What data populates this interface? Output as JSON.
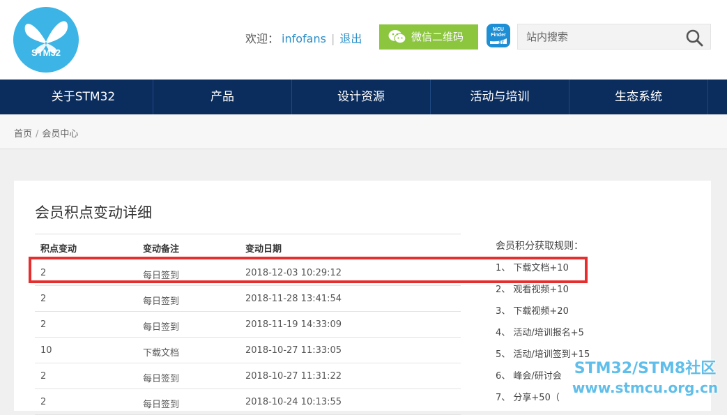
{
  "header": {
    "logo_text": "STM32",
    "welcome_label": "欢迎：",
    "username": "infofans",
    "separator": "|",
    "logout": "退出",
    "wechat_button": "微信二维码",
    "mcu_finder": {
      "line1": "MCU",
      "line2": "Finder",
      "brand": "ST"
    },
    "search_placeholder": "站内搜索",
    "brand_color": "#3cb4e5",
    "wechat_color": "#8cc63f"
  },
  "nav": {
    "background": "#0b2d5e",
    "items": [
      "关于STM32",
      "产品",
      "设计资源",
      "活动与培训",
      "生态系统"
    ]
  },
  "breadcrumb": {
    "home": "首页",
    "separator": "/",
    "current": "会员中心"
  },
  "points": {
    "title": "会员积点变动详细",
    "columns": [
      "积点变动",
      "变动备注",
      "变动日期"
    ],
    "rows": [
      {
        "change": "2",
        "note": "每日签到",
        "date": "2018-12-03 10:29:12"
      },
      {
        "change": "2",
        "note": "每日签到",
        "date": "2018-11-28 13:41:54"
      },
      {
        "change": "2",
        "note": "每日签到",
        "date": "2018-11-19 14:33:09"
      },
      {
        "change": "10",
        "note": "下载文档",
        "date": "2018-10-27 11:33:05"
      },
      {
        "change": "2",
        "note": "每日签到",
        "date": "2018-10-27 11:31:22"
      },
      {
        "change": "2",
        "note": "每日签到",
        "date": "2018-10-24 10:13:55"
      }
    ]
  },
  "rules": {
    "title": "会员积分获取规则：",
    "items": [
      "1、 下载文档+10",
      "2、 观看视频+10",
      "3、 下载视频+20",
      "4、 活动/培训报名+5",
      "5、 活动/培训签到+15",
      "6、 峰会/研讨会",
      "7、 分享+50（"
    ]
  },
  "watermark": {
    "line1": "STM32/STM8社区",
    "line2": "www.stmcu.org.cn"
  },
  "highlight_color": "#e62e2e"
}
